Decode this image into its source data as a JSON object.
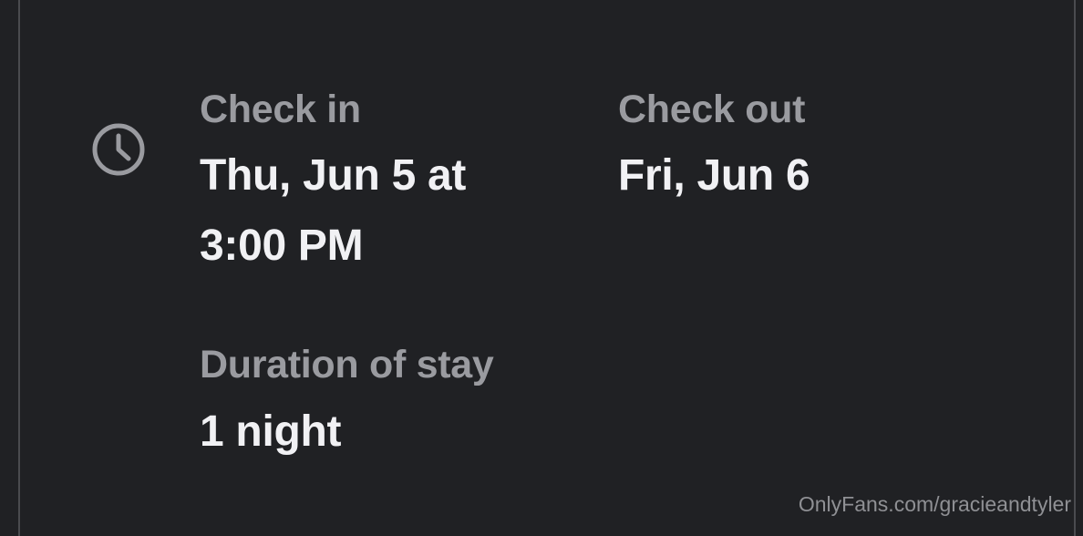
{
  "checkin": {
    "label": "Check in",
    "value_line1": "Thu, Jun 5 at",
    "value_line2": "3:00 PM"
  },
  "checkout": {
    "label": "Check out",
    "value": "Fri, Jun 6"
  },
  "duration": {
    "label": "Duration of stay",
    "value": "1 night"
  },
  "watermark": "OnlyFans.com/gracieandtyler",
  "icons": {
    "clock": "clock-icon"
  },
  "colors": {
    "background": "#202124",
    "label": "#9a9ba0",
    "value": "#f1f1f4"
  }
}
